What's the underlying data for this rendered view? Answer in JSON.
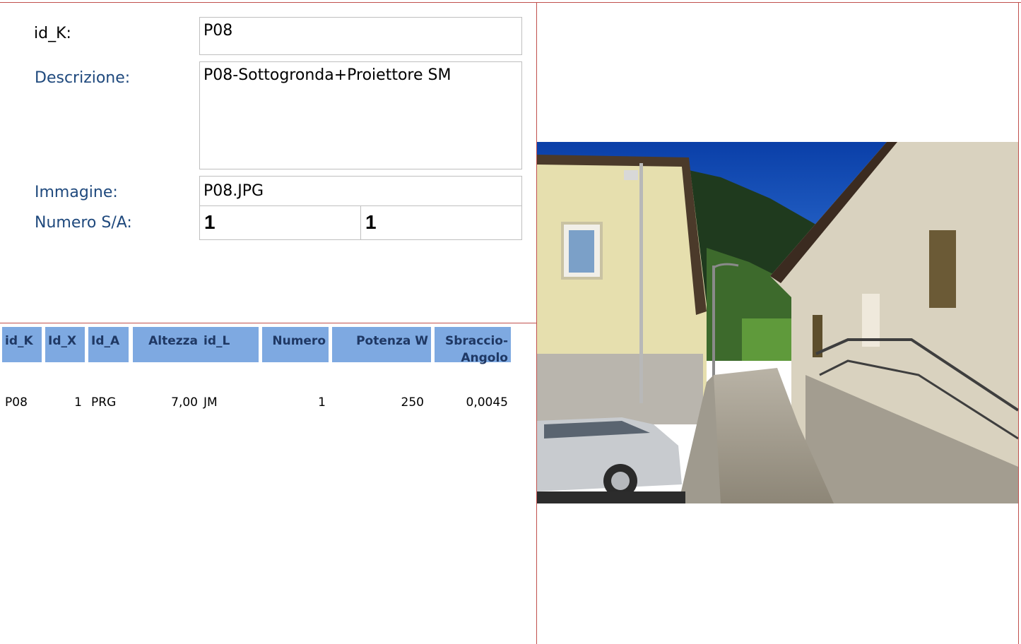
{
  "form": {
    "id_k_label": "id_K:",
    "id_k_value": "P08",
    "descrizione_label": "Descrizione:",
    "descrizione_value": "P08-Sottogronda+Proiettore SM",
    "immagine_label": "Immagine:",
    "immagine_value": "P08.JPG",
    "numero_label": "Numero S/A:",
    "numero_s": "1",
    "numero_a": "1"
  },
  "table": {
    "headers": [
      "id_K",
      "Id_X",
      "Id_A",
      "Altezza",
      "id_L",
      "Numero",
      "Potenza W",
      "Sbraccio-Angolo"
    ],
    "header_sbraccio_line1": "Sbraccio-",
    "header_sbraccio_line2": "Angolo",
    "row": [
      "P08",
      "1",
      "PRG",
      "7,00",
      "JM",
      "1",
      "250",
      "0,0045"
    ]
  },
  "colors": {
    "accent_border": "#c0504d",
    "header_fill": "#7ea9e1",
    "label_text": "#1f497d"
  }
}
